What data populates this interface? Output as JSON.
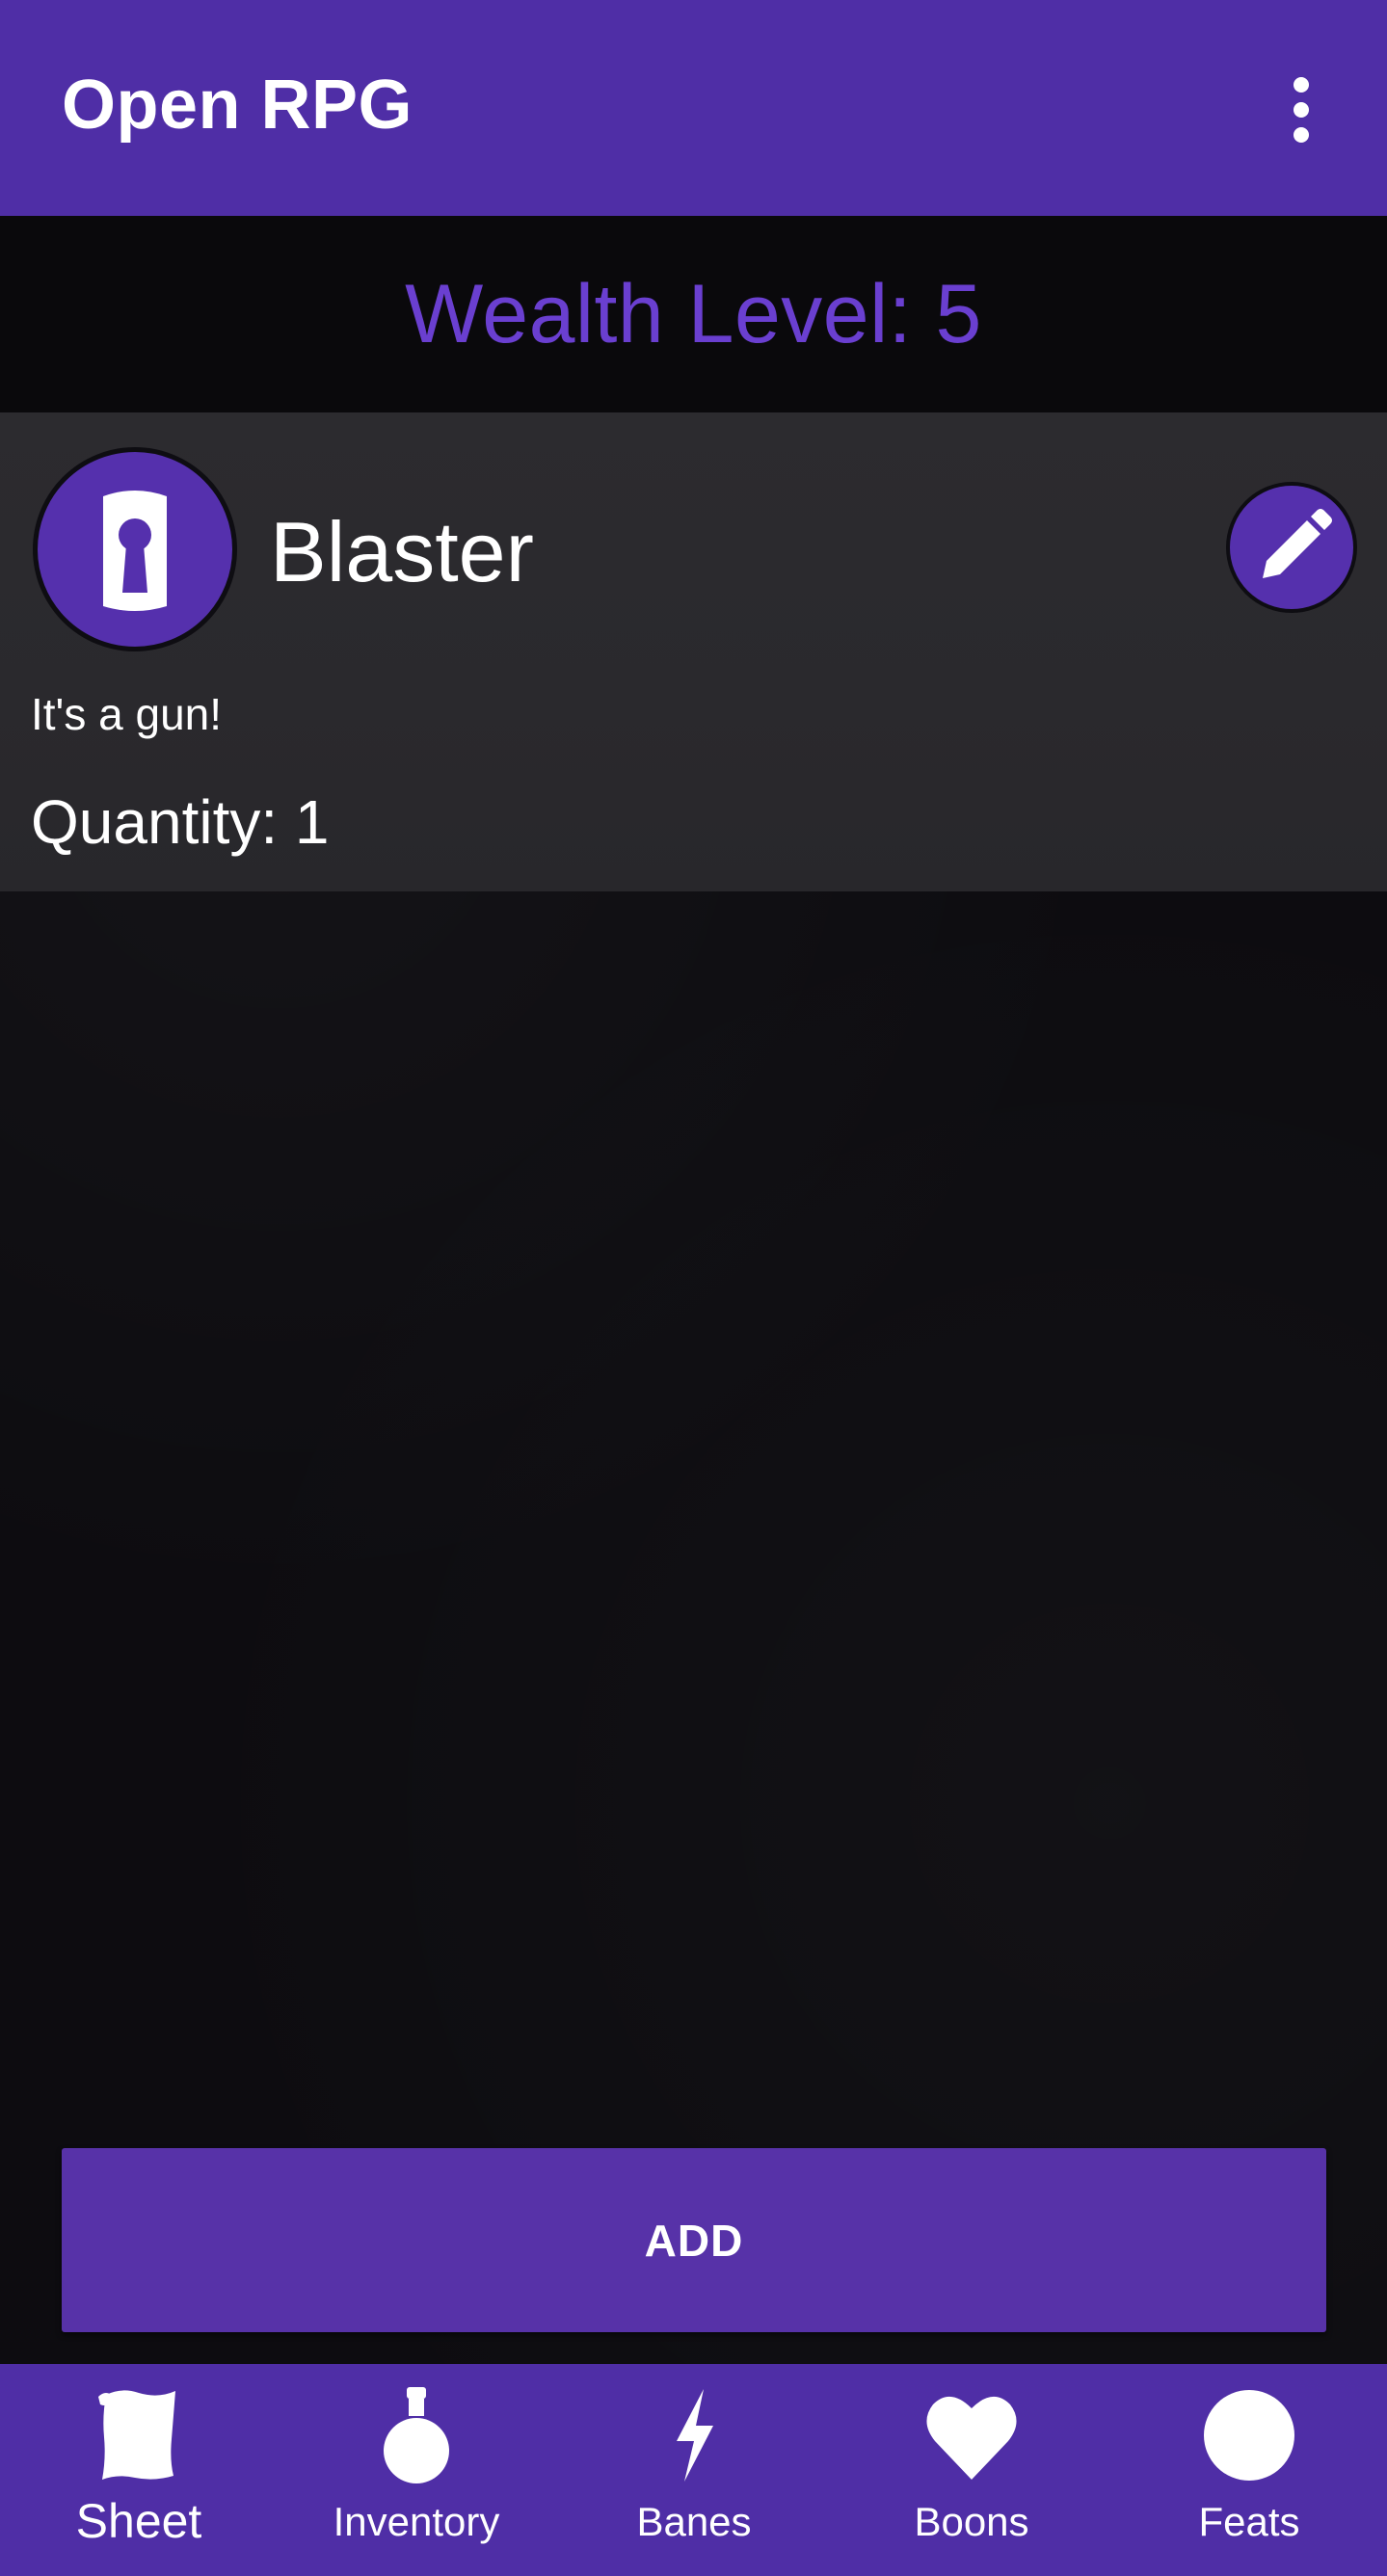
{
  "app": {
    "title": "Open RPG"
  },
  "appbar": {
    "overflow_icon": "more-vert-icon"
  },
  "wealth": {
    "label": "Wealth Level: 5"
  },
  "inventory": {
    "items": [
      {
        "icon": "keyhole-shield-icon",
        "name": "Blaster",
        "description": "It's a gun!",
        "quantity_label": "Quantity: 1",
        "edit_icon": "pencil-icon"
      }
    ]
  },
  "actions": {
    "add_label": "ADD"
  },
  "bottom_nav": {
    "active": "Sheet",
    "items": [
      {
        "label": "Sheet",
        "icon": "scroll-icon"
      },
      {
        "label": "Inventory",
        "icon": "potion-icon"
      },
      {
        "label": "Banes",
        "icon": "lightning-icon"
      },
      {
        "label": "Boons",
        "icon": "heart-icon"
      },
      {
        "label": "Feats",
        "icon": "circle-icon"
      }
    ]
  },
  "colors": {
    "primary": "#4f2ea6",
    "accent_text": "#6a3fd0",
    "button": "#5732a8",
    "background": "#0d0c10",
    "card": "#2c2b2f"
  }
}
